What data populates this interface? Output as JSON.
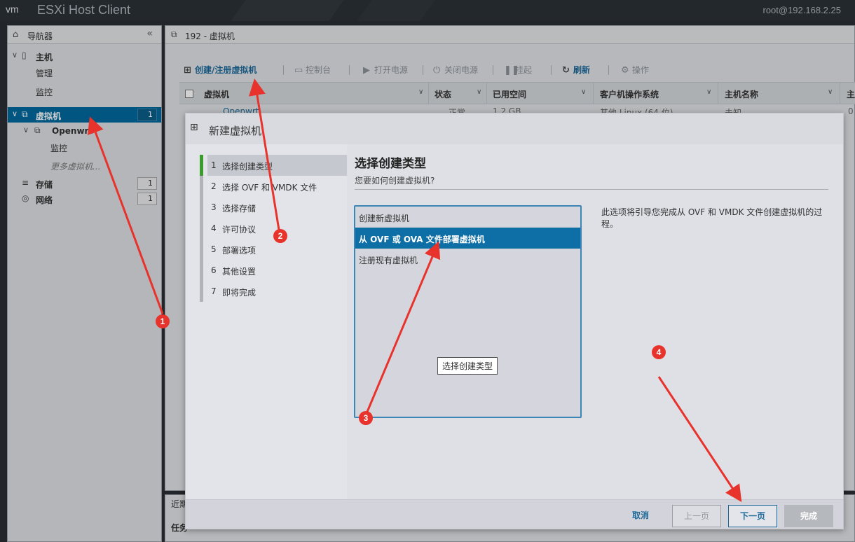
{
  "topbar": {
    "logo": "vm",
    "app_title": "ESXi Host Client",
    "user": "root@192.168.2.25"
  },
  "navigator": {
    "title": "导航器",
    "host": {
      "label": "主机",
      "children": [
        "管理",
        "监控"
      ]
    },
    "vms": {
      "label": "虚拟机",
      "count": "1",
      "vm_name": "Openwrt",
      "vm_children": [
        "监控"
      ],
      "more": "更多虚拟机..."
    },
    "storage": {
      "label": "存储",
      "count": "1"
    },
    "network": {
      "label": "网络",
      "count": "1"
    }
  },
  "content": {
    "header": "192 - 虚拟机",
    "toolbar": {
      "create": "创建/注册虚拟机",
      "console": "控制台",
      "power_on": "打开电源",
      "power_off": "关闭电源",
      "suspend": "挂起",
      "refresh": "刷新",
      "actions": "操作"
    },
    "grid": {
      "columns": [
        "虚拟机",
        "状态",
        "已用空间",
        "客户机操作系统",
        "主机名称",
        "主"
      ],
      "row": [
        "Openwrt",
        "正常",
        "1.2 GB",
        "其他 Linux (64 位)",
        "未知",
        "0"
      ]
    }
  },
  "tasks": {
    "header": "近期任务",
    "column": "任务"
  },
  "dialog": {
    "title": "新建虚拟机",
    "steps": [
      {
        "num": "1",
        "label": "选择创建类型"
      },
      {
        "num": "2",
        "label": "选择 OVF 和 VMDK 文件"
      },
      {
        "num": "3",
        "label": "选择存储"
      },
      {
        "num": "4",
        "label": "许可协议"
      },
      {
        "num": "5",
        "label": "部署选项"
      },
      {
        "num": "6",
        "label": "其他设置"
      },
      {
        "num": "7",
        "label": "即将完成"
      }
    ],
    "heading": "选择创建类型",
    "subtitle": "您要如何创建虚拟机?",
    "options": [
      "创建新虚拟机",
      "从 OVF 或 OVA 文件部署虚拟机",
      "注册现有虚拟机"
    ],
    "selected_index": 1,
    "tooltip": "选择创建类型",
    "description": "此选项将引导您完成从 OVF 和 VMDK 文件创建虚拟机的过程。",
    "buttons": {
      "cancel": "取消",
      "back": "上一页",
      "next": "下一页",
      "finish": "完成"
    }
  },
  "annotations": {
    "markers": [
      "1",
      "2",
      "3",
      "4"
    ],
    "color": "#e8322c"
  }
}
